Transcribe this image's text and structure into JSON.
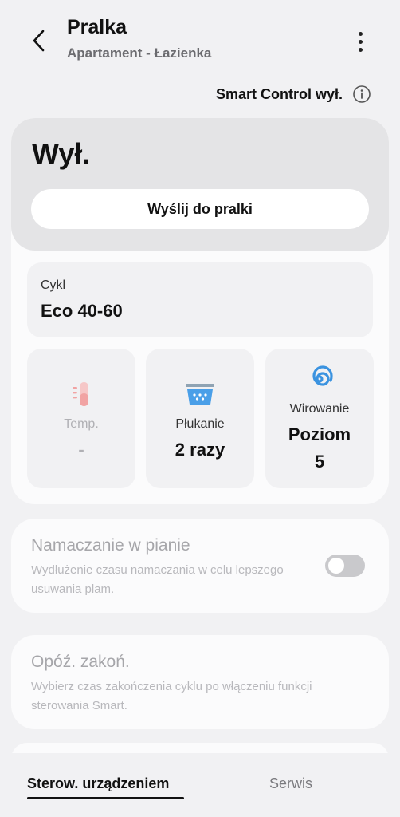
{
  "header": {
    "title": "Pralka",
    "subtitle": "Apartament - Łazienka"
  },
  "smart_control": {
    "label": "Smart Control wył."
  },
  "status": {
    "state": "Wył.",
    "send_button": "Wyślij do pralki"
  },
  "cycle": {
    "label": "Cykl",
    "value": "Eco 40-60"
  },
  "tiles": [
    {
      "label": "Temp.",
      "value": "-",
      "icon": "thermometer-icon",
      "enabled": false
    },
    {
      "label": "Płukanie",
      "value": "2 razy",
      "icon": "rinse-icon",
      "enabled": true
    },
    {
      "label": "Wirowanie",
      "value": "Poziom 5",
      "icon": "spin-icon",
      "enabled": true
    }
  ],
  "soak": {
    "title": "Namaczanie w pianie",
    "description": "Wydłużenie czasu namaczania w celu lepszego usuwania plam.",
    "enabled": false
  },
  "delay_end": {
    "title": "Opóź. zakoń.",
    "description": "Wybierz czas zakończenia cyklu po włączeniu funkcji sterowania Smart."
  },
  "bottom_nav": {
    "tabs": [
      {
        "label": "Sterow. urządzeniem",
        "active": true
      },
      {
        "label": "Serwis",
        "active": false
      }
    ]
  },
  "colors": {
    "background": "#f1f1f3",
    "card": "#fbfbfc",
    "status_panel": "#e4e4e6",
    "temp_icon": "#f1a3a3",
    "rinse_icon": "#4a9fe8",
    "spin_icon": "#3b93e0",
    "toggle_off": "#c9c9cc"
  }
}
